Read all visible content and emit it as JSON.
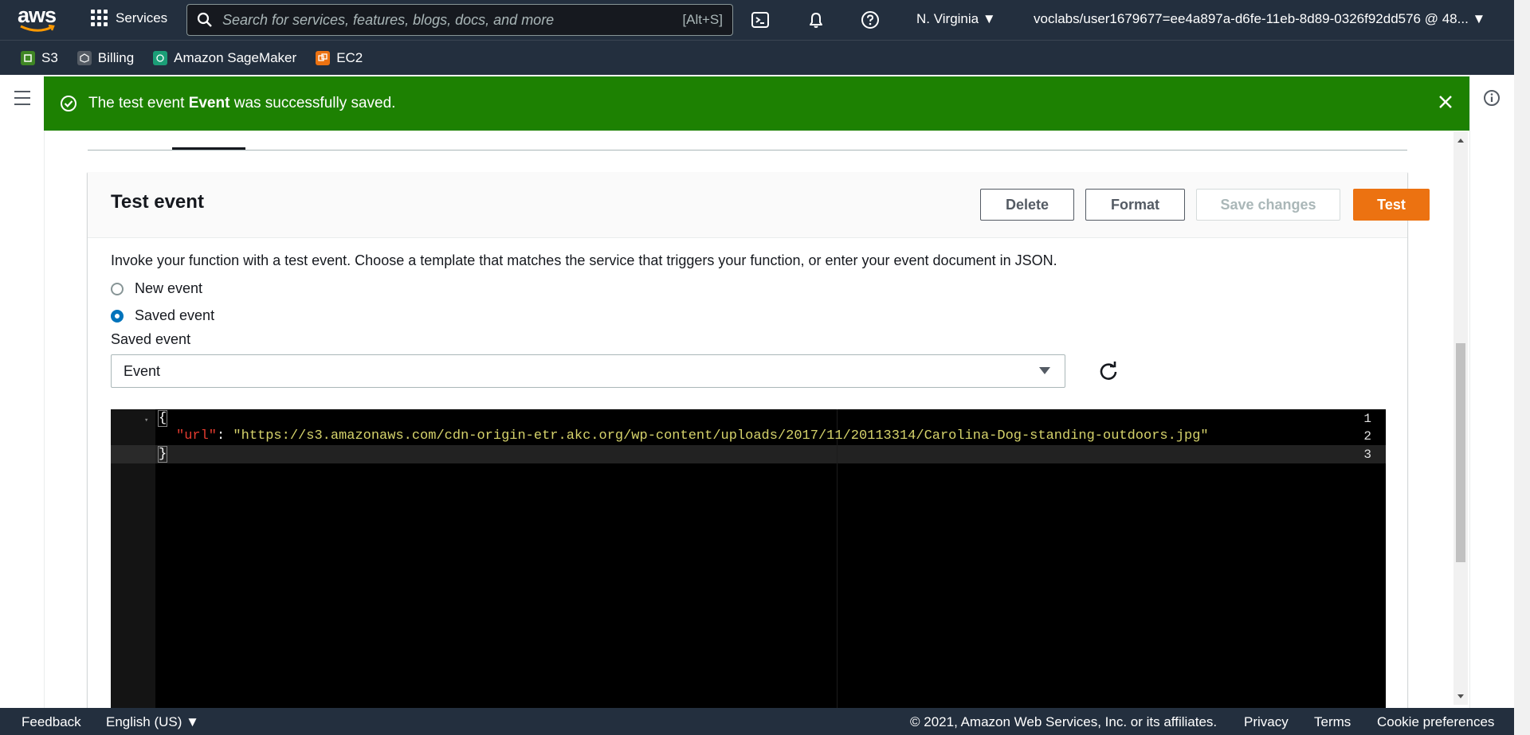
{
  "nav": {
    "logo": "aws",
    "services_label": "Services",
    "search_placeholder": "Search for services, features, blogs, docs, and more",
    "search_shortcut": "[Alt+S]",
    "region": "N. Virginia ▼",
    "account": "voclabs/user1679677=ee4a897a-d6fe-11eb-8d89-0326f92dd576 @ 48... ▼"
  },
  "favorites": [
    {
      "label": "S3",
      "color": "#3f8624"
    },
    {
      "label": "Billing",
      "color": "#545b64"
    },
    {
      "label": "Amazon SageMaker",
      "color": "#1b9e77"
    },
    {
      "label": "EC2",
      "color": "#ec7211"
    }
  ],
  "flash": {
    "prefix": "The test event ",
    "bold": "Event",
    "suffix": " was successfully saved.",
    "color": "#1d8102"
  },
  "panel": {
    "title": "Test event",
    "buttons": {
      "delete": "Delete",
      "format": "Format",
      "save": "Save changes",
      "test": "Test"
    },
    "description": "Invoke your function with a test event. Choose a template that matches the service that triggers your function, or enter your event document in JSON.",
    "radio_new": "New event",
    "radio_saved": "Saved event",
    "selected_radio": "Saved event",
    "field_label": "Saved event",
    "select_value": "Event"
  },
  "editor": {
    "line_numbers": [
      "1",
      "2",
      "3"
    ],
    "line1": "{",
    "line2_key": "\"url\"",
    "line2_colon": ": ",
    "line2_value": "\"https://s3.amazonaws.com/cdn-origin-etr.akc.org/wp-content/uploads/2017/11/20113314/Carolina-Dog-standing-outdoors.jpg\"",
    "line3": "}"
  },
  "footer": {
    "feedback": "Feedback",
    "language": "English (US) ▼",
    "copyright": "© 2021, Amazon Web Services, Inc. or its affiliates.",
    "privacy": "Privacy",
    "terms": "Terms",
    "cookies": "Cookie preferences"
  }
}
